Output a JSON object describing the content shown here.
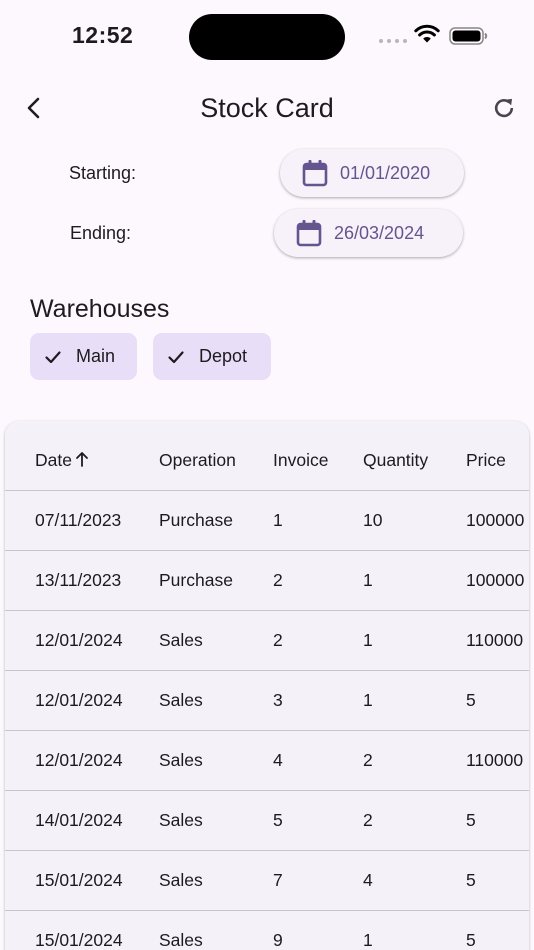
{
  "status_bar": {
    "time": "12:52"
  },
  "header": {
    "title": "Stock Card"
  },
  "filters": {
    "starting_label": "Starting:",
    "starting_date": "01/01/2020",
    "ending_label": "Ending:",
    "ending_date": "26/03/2024"
  },
  "warehouses": {
    "title": "Warehouses",
    "chips": [
      {
        "label": "Main",
        "selected": true
      },
      {
        "label": "Depot",
        "selected": true
      }
    ]
  },
  "table": {
    "columns": [
      "Date",
      "Operation",
      "Invoice",
      "Quantity",
      "Price"
    ],
    "sort_column": "Date",
    "sort_direction": "ascending",
    "rows": [
      [
        "07/11/2023",
        "Purchase",
        "1",
        "10",
        "100000"
      ],
      [
        "13/11/2023",
        "Purchase",
        "2",
        "1",
        "100000"
      ],
      [
        "12/01/2024",
        "Sales",
        "2",
        "1",
        "110000"
      ],
      [
        "12/01/2024",
        "Sales",
        "3",
        "1",
        "5"
      ],
      [
        "12/01/2024",
        "Sales",
        "4",
        "2",
        "110000"
      ],
      [
        "14/01/2024",
        "Sales",
        "5",
        "2",
        "5"
      ],
      [
        "15/01/2024",
        "Sales",
        "7",
        "4",
        "5"
      ],
      [
        "15/01/2024",
        "Sales",
        "9",
        "1",
        "5"
      ]
    ]
  },
  "colors": {
    "accent": "#65558f",
    "chip_background": "#e8def8",
    "background": "#fdf8fd",
    "card_background": "#f5f1f8",
    "divider": "#cac4d0"
  }
}
